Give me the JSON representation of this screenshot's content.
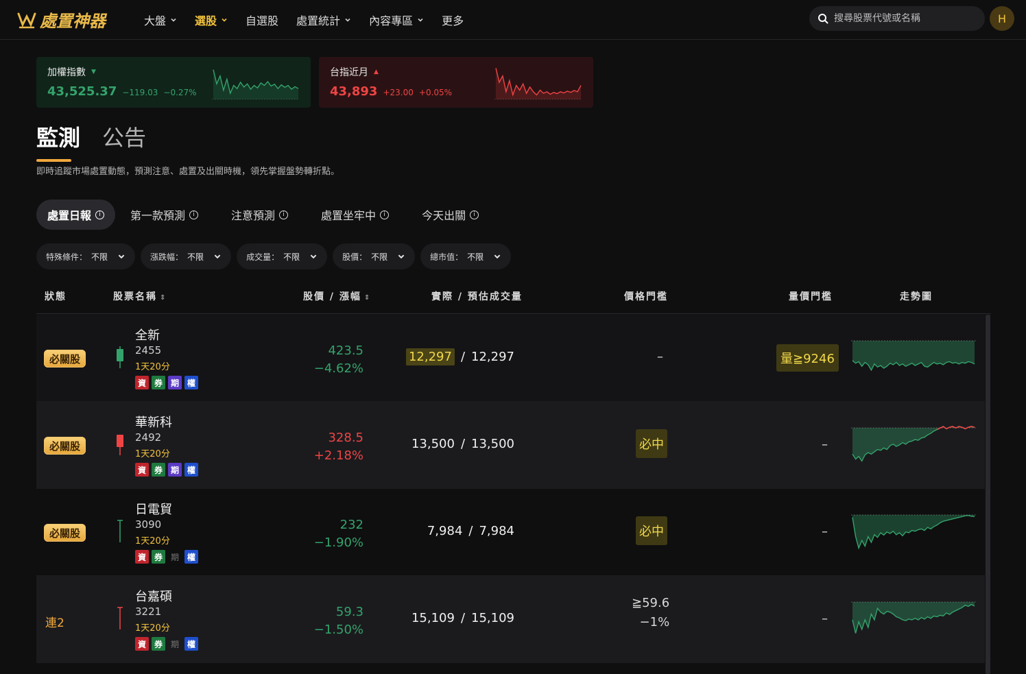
{
  "brand": {
    "name": "處置神器"
  },
  "nav": [
    {
      "label": "大盤",
      "has_menu": true,
      "active": false
    },
    {
      "label": "選股",
      "has_menu": true,
      "active": true
    },
    {
      "label": "自選股",
      "has_menu": false,
      "active": false
    },
    {
      "label": "處置統計",
      "has_menu": true,
      "active": false
    },
    {
      "label": "內容專區",
      "has_menu": true,
      "active": false
    },
    {
      "label": "更多",
      "has_menu": false,
      "active": false
    }
  ],
  "search": {
    "placeholder": "搜尋股票代號或名稱",
    "value": ""
  },
  "user": {
    "avatar_letter": "H"
  },
  "indices": [
    {
      "name": "加權指數",
      "direction": "down",
      "value": "43,525.37",
      "change": "−119.03",
      "pct": "−0.27%"
    },
    {
      "name": "台指近月",
      "direction": "up",
      "value": "43,893",
      "change": "+23.00",
      "pct": "+0.05%"
    }
  ],
  "main_tabs": [
    {
      "label": "監測",
      "active": true
    },
    {
      "label": "公告",
      "active": false
    }
  ],
  "subtitle": "即時追蹤市場處置動態，預測注意、處置及出關時機，領先掌握盤勢轉折點。",
  "sub_tabs": [
    {
      "label": "處置日報",
      "active": true
    },
    {
      "label": "第一款預測",
      "active": false
    },
    {
      "label": "注意預測",
      "active": false
    },
    {
      "label": "處置坐牢中",
      "active": false
    },
    {
      "label": "今天出關",
      "active": false
    }
  ],
  "filters": [
    {
      "label": "特殊條件：",
      "value": "不限"
    },
    {
      "label": "漲跌幅：",
      "value": "不限"
    },
    {
      "label": "成交量：",
      "value": "不限"
    },
    {
      "label": "股價：",
      "value": "不限"
    },
    {
      "label": "總市值：",
      "value": "不限"
    }
  ],
  "columns": {
    "status": "狀態",
    "name": "股票名稱",
    "price": "股價 / 漲幅",
    "volume": "實際 / 預估成交量",
    "price_threshold": "價格門檻",
    "vol_threshold": "量價門檻",
    "trend": "走勢圖"
  },
  "colors": {
    "up": "#ef4444",
    "down": "#34a36b",
    "accent": "#f2c23c"
  },
  "rows": [
    {
      "status": "必關股",
      "status_type": "badge",
      "name": "全新",
      "code": "2455",
      "duration": "1天20分",
      "candle": "down",
      "tags": [
        {
          "t": "資",
          "on": true,
          "c": "r"
        },
        {
          "t": "券",
          "on": true,
          "c": "g"
        },
        {
          "t": "期",
          "on": true,
          "c": "p"
        },
        {
          "t": "權",
          "on": true,
          "c": "b"
        }
      ],
      "price": "423.5",
      "change": "−4.62%",
      "dir": "down",
      "vol_actual": "12,297",
      "vol_sep": "/",
      "vol_est": "12,297",
      "vol_highlight": true,
      "price_threshold": "–",
      "price_threshold_line2": "",
      "pt_type": "plain",
      "vol_threshold": "量≧9246",
      "vt_type": "box",
      "trend": [
        0.55,
        0.62,
        0.58,
        0.7,
        0.6,
        0.66,
        0.8,
        0.64,
        0.72,
        0.68,
        0.75,
        0.7,
        0.62,
        0.66,
        0.6,
        0.68,
        0.64,
        0.7,
        0.66,
        0.62,
        0.68,
        0.64,
        0.6,
        0.7,
        0.72,
        0.66,
        0.6,
        0.64,
        0.62,
        0.66,
        0.6,
        0.58,
        0.62,
        0.6,
        0.64,
        0.6,
        0.62,
        0.58,
        0.6,
        0.64
      ],
      "trend_up": false
    },
    {
      "status": "必關股",
      "status_type": "badge",
      "name": "華新科",
      "code": "2492",
      "duration": "1天20分",
      "candle": "up",
      "tags": [
        {
          "t": "資",
          "on": true,
          "c": "r"
        },
        {
          "t": "券",
          "on": true,
          "c": "g"
        },
        {
          "t": "期",
          "on": true,
          "c": "p"
        },
        {
          "t": "權",
          "on": true,
          "c": "b"
        }
      ],
      "price": "328.5",
      "change": "+2.18%",
      "dir": "up",
      "vol_actual": "13,500",
      "vol_sep": "/",
      "vol_est": "13,500",
      "vol_highlight": false,
      "price_threshold": "必中",
      "price_threshold_line2": "",
      "pt_type": "box",
      "vol_threshold": "–",
      "vt_type": "plain",
      "trend": [
        0.72,
        0.85,
        0.78,
        0.9,
        0.74,
        0.68,
        0.72,
        0.66,
        0.6,
        0.62,
        0.56,
        0.6,
        0.5,
        0.46,
        0.52,
        0.48,
        0.42,
        0.46,
        0.4,
        0.38,
        0.34,
        0.36,
        0.3,
        0.28,
        0.22,
        0.18,
        0.12,
        0.08,
        0.04,
        0.0,
        0.06,
        0.02,
        0.0,
        0.04,
        0.0,
        0.02,
        0.06,
        0.02,
        0.0,
        0.02
      ],
      "trend_up": true
    },
    {
      "status": "必關股",
      "status_type": "badge",
      "name": "日電貿",
      "code": "3090",
      "duration": "1天20分",
      "candle": "flat",
      "tags": [
        {
          "t": "資",
          "on": true,
          "c": "r"
        },
        {
          "t": "券",
          "on": true,
          "c": "g"
        },
        {
          "t": "期",
          "on": false,
          "c": "p"
        },
        {
          "t": "權",
          "on": true,
          "c": "b"
        }
      ],
      "price": "232",
      "change": "−1.90%",
      "dir": "down",
      "vol_actual": "7,984",
      "vol_sep": "/",
      "vol_est": "7,984",
      "vol_highlight": false,
      "price_threshold": "必中",
      "price_threshold_line2": "",
      "pt_type": "box",
      "vol_threshold": "–",
      "vt_type": "plain",
      "trend": [
        0.1,
        0.6,
        0.9,
        0.7,
        0.85,
        0.6,
        0.75,
        0.55,
        0.62,
        0.5,
        0.56,
        0.48,
        0.52,
        0.46,
        0.55,
        0.5,
        0.58,
        0.48,
        0.5,
        0.44,
        0.46,
        0.42,
        0.4,
        0.44,
        0.36,
        0.4,
        0.34,
        0.3,
        0.24,
        0.2,
        0.18,
        0.16,
        0.14,
        0.12,
        0.1,
        0.08,
        0.06,
        0.05,
        0.07,
        0.08
      ],
      "trend_up": false
    },
    {
      "status": "連2",
      "status_type": "text",
      "name": "台嘉碩",
      "code": "3221",
      "duration": "1天20分",
      "candle": "up-thin",
      "tags": [
        {
          "t": "資",
          "on": true,
          "c": "r"
        },
        {
          "t": "券",
          "on": true,
          "c": "g"
        },
        {
          "t": "期",
          "on": false,
          "c": "p"
        },
        {
          "t": "權",
          "on": true,
          "c": "b"
        }
      ],
      "price": "59.3",
      "change": "−1.50%",
      "dir": "down",
      "vol_actual": "15,109",
      "vol_sep": "/",
      "vol_est": "15,109",
      "vol_highlight": false,
      "price_threshold": "≧59.6",
      "price_threshold_line2": "−1%",
      "pt_type": "two",
      "vol_threshold": "–",
      "vt_type": "plain",
      "trend": [
        0.5,
        0.85,
        0.55,
        0.75,
        0.5,
        0.7,
        0.35,
        0.5,
        0.2,
        0.3,
        0.35,
        0.28,
        0.3,
        0.35,
        0.42,
        0.45,
        0.5,
        0.52,
        0.48,
        0.5,
        0.46,
        0.5,
        0.44,
        0.48,
        0.42,
        0.46,
        0.4,
        0.42,
        0.38,
        0.4,
        0.32,
        0.36,
        0.3,
        0.26,
        0.22,
        0.18,
        0.12,
        0.15,
        0.1,
        0.14
      ],
      "trend_up": false
    }
  ]
}
